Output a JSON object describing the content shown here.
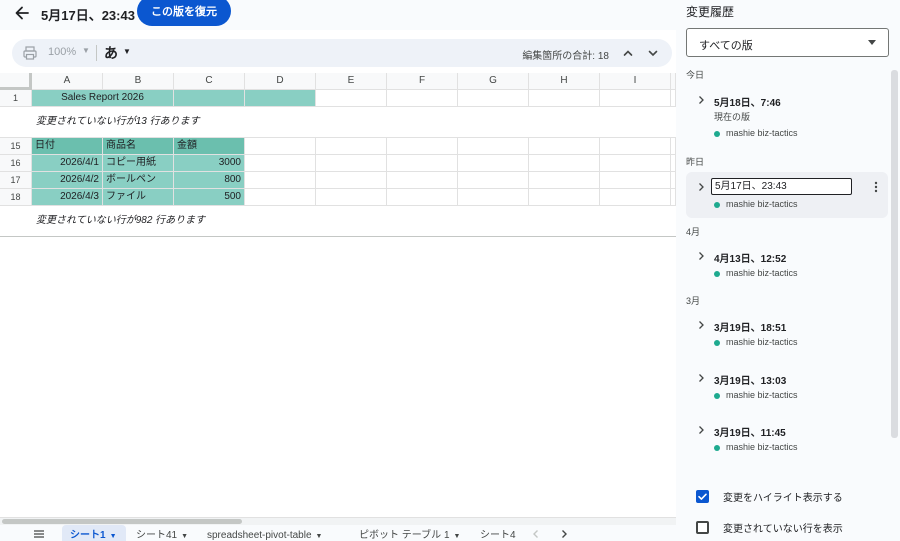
{
  "header": {
    "title": "5月17日、23:43",
    "restore_button": "この版を復元"
  },
  "toolbar": {
    "zoom": "100%",
    "input_mode": "あ",
    "edit_count": "編集箇所の合計: 18"
  },
  "grid": {
    "columns": [
      "A",
      "B",
      "C",
      "D",
      "E",
      "F",
      "G",
      "H",
      "I"
    ],
    "row1": {
      "num": "1",
      "title": "Sales Report 2026"
    },
    "collapsed_1": "変更されていない行が13 行あります",
    "row15": {
      "num": "15",
      "a": "日付",
      "b": "商品名",
      "c": "金額"
    },
    "row16": {
      "num": "16",
      "a": "2026/4/1",
      "b": "コピー用紙",
      "c": "3000"
    },
    "row17": {
      "num": "17",
      "a": "2026/4/2",
      "b": "ボールペン",
      "c": "800"
    },
    "row18": {
      "num": "18",
      "a": "2026/4/3",
      "b": "ファイル",
      "c": "500"
    },
    "collapsed_2": "変更されていない行が982 行あります"
  },
  "sheets": {
    "tabs": [
      "シート1",
      "シート41",
      "spreadsheet-pivot-table",
      "ピボット テーブル 1",
      "シート4"
    ]
  },
  "panel": {
    "title": "変更履歴",
    "filter": "すべての版",
    "sections": {
      "today": "今日",
      "yesterday": "昨日",
      "april": "4月",
      "march": "3月"
    },
    "versions": [
      {
        "time": "5月18日、7:46",
        "current": "現在の版",
        "author": "mashie biz-tactics"
      },
      {
        "time": "5月17日、23:43",
        "author": "mashie biz-tactics"
      },
      {
        "time": "4月13日、12:52",
        "author": "mashie biz-tactics"
      },
      {
        "time": "3月19日、18:51",
        "author": "mashie biz-tactics"
      },
      {
        "time": "3月19日、13:03",
        "author": "mashie biz-tactics"
      },
      {
        "time": "3月19日、11:45",
        "author": "mashie biz-tactics"
      }
    ],
    "options": {
      "highlight": "変更をハイライト表示する",
      "show_unchanged": "変更されていない行を表示"
    }
  },
  "colors": {
    "accent": "#0b57d0",
    "cell_fill": "#89cfc3",
    "header_fill": "#6bbfae",
    "author_dot": "#1eaa8f"
  }
}
